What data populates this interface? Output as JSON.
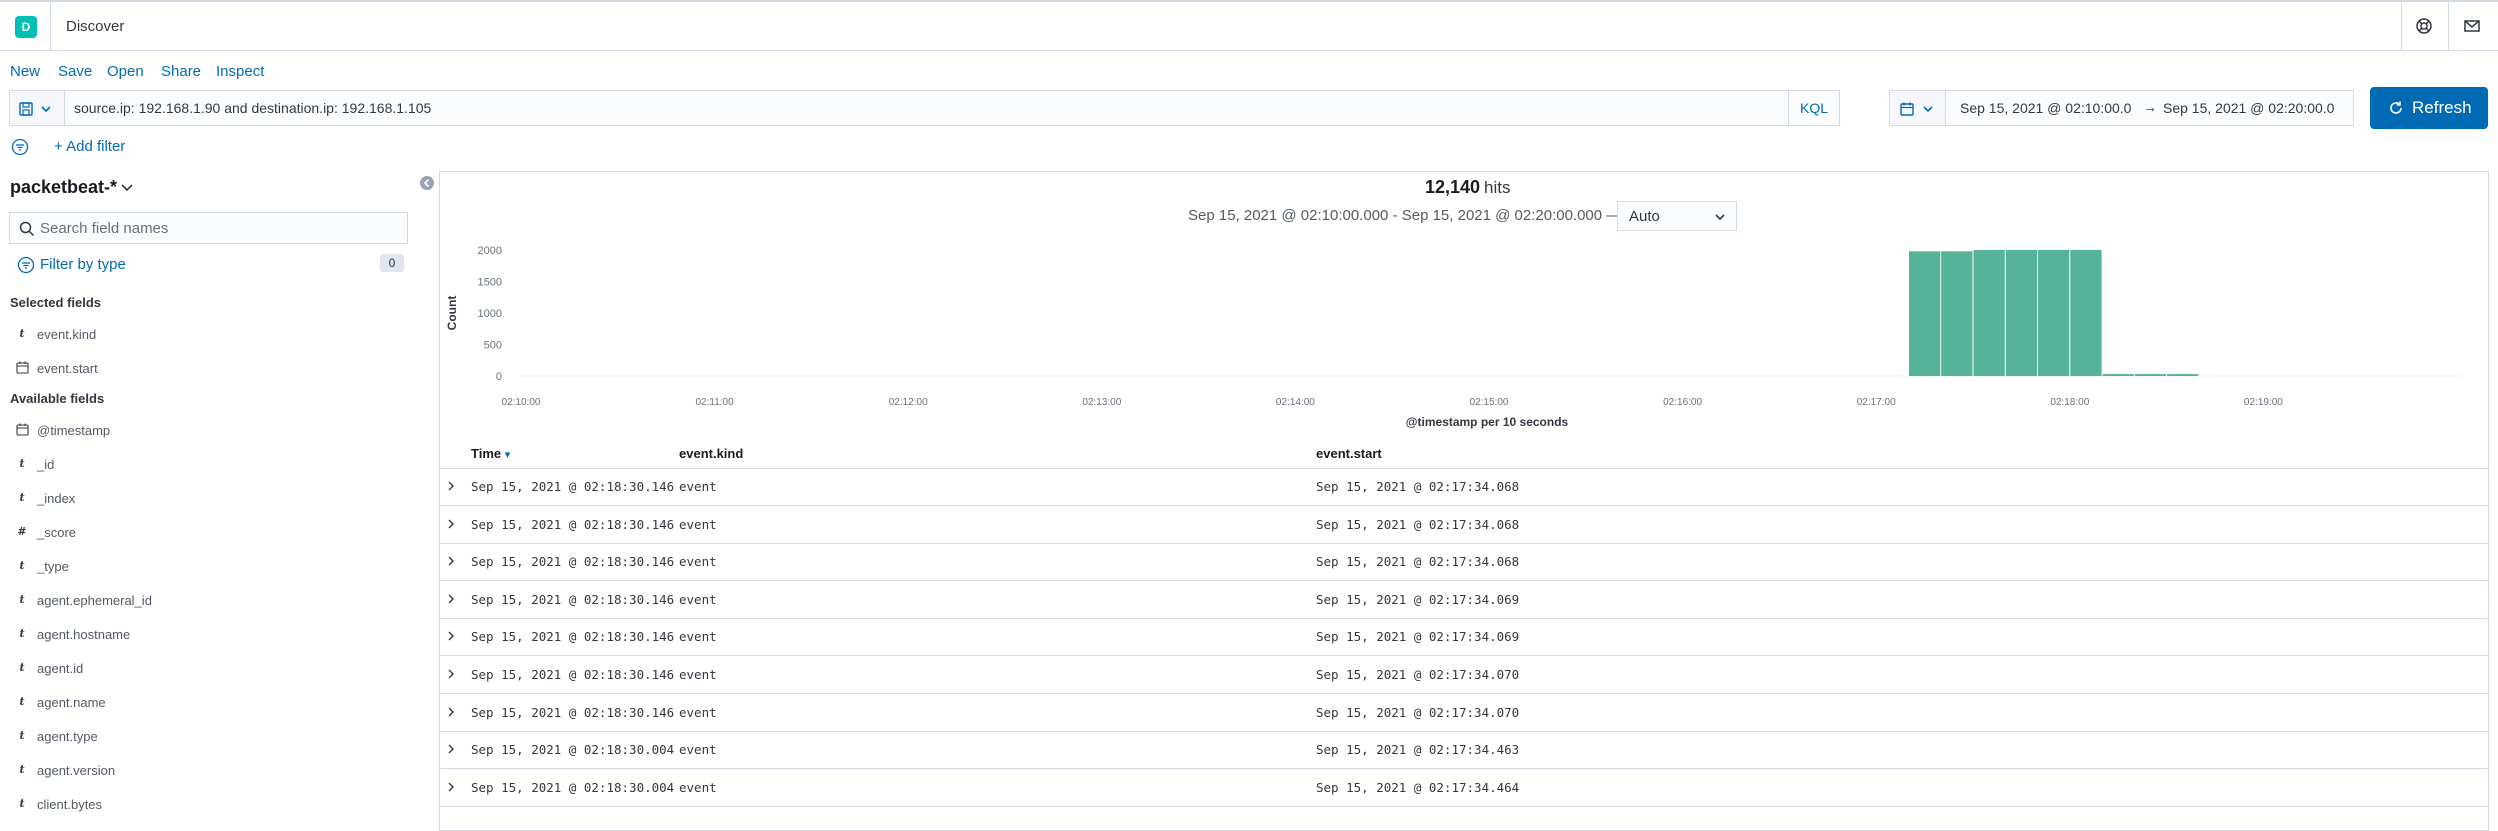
{
  "header": {
    "logo_letter": "D",
    "title": "Discover",
    "icons": [
      "help-icon",
      "mail-icon"
    ]
  },
  "top_nav": {
    "new": "New",
    "save": "Save",
    "open": "Open",
    "share": "Share",
    "inspect": "Inspect"
  },
  "query": {
    "value": "source.ip: 192.168.1.90 and destination.ip: 192.168.1.105",
    "language": "KQL"
  },
  "date_range": {
    "start": "Sep 15, 2021 @ 02:10:00.0",
    "arrow": "→",
    "end": "Sep 15, 2021 @ 02:20:00.0"
  },
  "refresh": {
    "label": "Refresh"
  },
  "filters": {
    "add_label": "+ Add filter"
  },
  "sidebar": {
    "index_pattern": "packetbeat-*",
    "search_placeholder": "Search field names",
    "filter_by_type": "Filter by type",
    "filter_count": "0",
    "selected_title": "Selected fields",
    "selected_fields": [
      {
        "type": "t",
        "name": "event.kind"
      },
      {
        "type": "date",
        "name": "event.start"
      }
    ],
    "available_title": "Available fields",
    "available_fields": [
      {
        "type": "date",
        "name": "@timestamp"
      },
      {
        "type": "t",
        "name": "_id"
      },
      {
        "type": "t",
        "name": "_index"
      },
      {
        "type": "#",
        "name": "_score"
      },
      {
        "type": "t",
        "name": "_type"
      },
      {
        "type": "t",
        "name": "agent.ephemeral_id"
      },
      {
        "type": "t",
        "name": "agent.hostname"
      },
      {
        "type": "t",
        "name": "agent.id"
      },
      {
        "type": "t",
        "name": "agent.name"
      },
      {
        "type": "t",
        "name": "agent.type"
      },
      {
        "type": "t",
        "name": "agent.version"
      },
      {
        "type": "t",
        "name": "client.bytes"
      }
    ]
  },
  "histogram": {
    "hits": "12,140",
    "hits_label": "hits",
    "range": "Sep 15, 2021 @ 02:10:00.000 - Sep 15, 2021 @ 02:20:00.000 —",
    "interval": "Auto"
  },
  "chart_data": {
    "type": "bar",
    "ylabel": "Count",
    "xlabel": "@timestamp per 10 seconds",
    "ylim": [
      0,
      2000
    ],
    "y_ticks": [
      "2000",
      "1500",
      "1000",
      "500",
      "0"
    ],
    "x_ticks": [
      "02:10:00",
      "02:11:00",
      "02:12:00",
      "02:13:00",
      "02:14:00",
      "02:15:00",
      "02:16:00",
      "02:17:00",
      "02:18:00",
      "02:19:00"
    ],
    "bin_seconds": 10,
    "bars": [
      {
        "start": "02:17:10",
        "count": 1980
      },
      {
        "start": "02:17:20",
        "count": 1980
      },
      {
        "start": "02:17:30",
        "count": 2000
      },
      {
        "start": "02:17:40",
        "count": 2000
      },
      {
        "start": "02:17:50",
        "count": 2000
      },
      {
        "start": "02:18:00",
        "count": 2000
      },
      {
        "start": "02:18:10",
        "count": 30
      },
      {
        "start": "02:18:20",
        "count": 30
      },
      {
        "start": "02:18:30",
        "count": 30
      }
    ],
    "color": "#54b399"
  },
  "table": {
    "columns": [
      "Time",
      "event.kind",
      "event.start"
    ],
    "sort_indicator": "▾",
    "rows": [
      [
        "Sep 15, 2021 @ 02:18:30.146",
        "event",
        "Sep 15, 2021 @ 02:17:34.068"
      ],
      [
        "Sep 15, 2021 @ 02:18:30.146",
        "event",
        "Sep 15, 2021 @ 02:17:34.068"
      ],
      [
        "Sep 15, 2021 @ 02:18:30.146",
        "event",
        "Sep 15, 2021 @ 02:17:34.068"
      ],
      [
        "Sep 15, 2021 @ 02:18:30.146",
        "event",
        "Sep 15, 2021 @ 02:17:34.069"
      ],
      [
        "Sep 15, 2021 @ 02:18:30.146",
        "event",
        "Sep 15, 2021 @ 02:17:34.069"
      ],
      [
        "Sep 15, 2021 @ 02:18:30.146",
        "event",
        "Sep 15, 2021 @ 02:17:34.070"
      ],
      [
        "Sep 15, 2021 @ 02:18:30.146",
        "event",
        "Sep 15, 2021 @ 02:17:34.070"
      ],
      [
        "Sep 15, 2021 @ 02:18:30.004",
        "event",
        "Sep 15, 2021 @ 02:17:34.463"
      ],
      [
        "Sep 15, 2021 @ 02:18:30.004",
        "event",
        "Sep 15, 2021 @ 02:17:34.464"
      ]
    ]
  },
  "colors": {
    "link": "#006bb4",
    "primary_button": "#006bb4",
    "logo": "#00bfb3",
    "border": "#d3dae6"
  }
}
